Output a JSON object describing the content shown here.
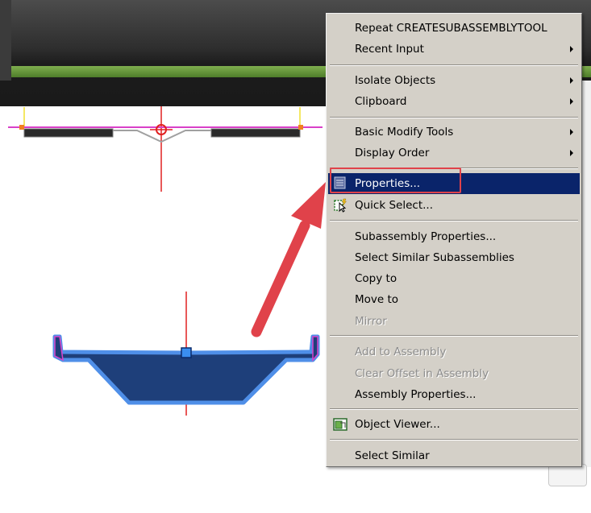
{
  "context_menu": {
    "items": [
      {
        "label": "Repeat CREATESUBASSEMBLYTOOL",
        "submenu": false,
        "enabled": true
      },
      {
        "label": "Recent Input",
        "submenu": true,
        "enabled": true
      },
      {
        "label": "Isolate Objects",
        "submenu": true,
        "enabled": true
      },
      {
        "label": "Clipboard",
        "submenu": true,
        "enabled": true
      },
      {
        "label": "Basic Modify Tools",
        "submenu": true,
        "enabled": true
      },
      {
        "label": "Display Order",
        "submenu": true,
        "enabled": true
      },
      {
        "label": "Properties...",
        "submenu": false,
        "enabled": true,
        "highlighted": true,
        "icon": "properties-icon"
      },
      {
        "label": "Quick Select...",
        "submenu": false,
        "enabled": true,
        "icon": "quick-select-icon"
      },
      {
        "label": "Subassembly Properties...",
        "submenu": false,
        "enabled": true
      },
      {
        "label": "Select Similar Subassemblies",
        "submenu": false,
        "enabled": true
      },
      {
        "label": "Copy to",
        "submenu": false,
        "enabled": true
      },
      {
        "label": "Move to",
        "submenu": false,
        "enabled": true
      },
      {
        "label": "Mirror",
        "submenu": false,
        "enabled": false
      },
      {
        "label": "Add to Assembly",
        "submenu": false,
        "enabled": false
      },
      {
        "label": "Clear Offset in Assembly",
        "submenu": false,
        "enabled": false
      },
      {
        "label": "Assembly Properties...",
        "submenu": false,
        "enabled": true
      },
      {
        "label": "Object Viewer...",
        "submenu": false,
        "enabled": true,
        "icon": "object-viewer-icon"
      },
      {
        "label": "Select Similar",
        "submenu": false,
        "enabled": true
      }
    ]
  },
  "colors": {
    "menu_background": "#d4d0c8",
    "menu_highlight": "#0a246a",
    "annotation_red": "#e0424a",
    "subassembly_fill": "#1e3f7a",
    "subassembly_outline": "#4f8fe8"
  }
}
